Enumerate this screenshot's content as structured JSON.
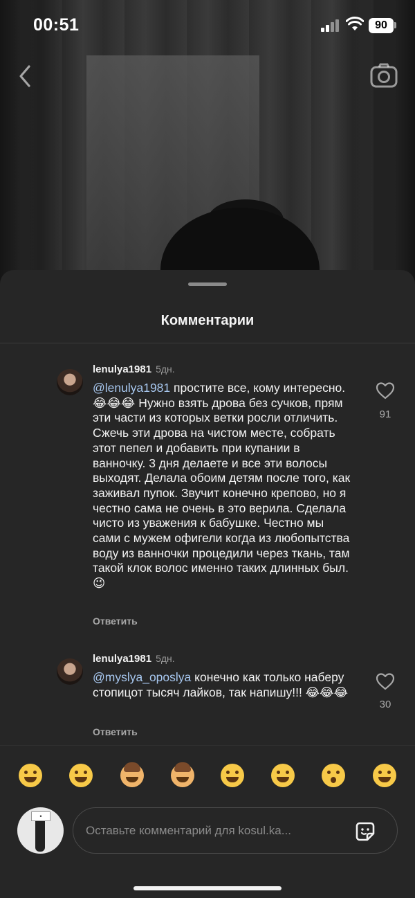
{
  "status_bar": {
    "time": "00:51",
    "battery": "90"
  },
  "sheet": {
    "title": "Комментарии"
  },
  "comments": [
    {
      "username": "lenulya1981",
      "time_ago": "5дн.",
      "mention": "@lenulya1981",
      "text": " простите все, кому интересно.😂😂😂 Нужно взять дрова без сучков,  прям эти части из которых ветки росли отличить. Сжечь эти дрова на чистом месте, собрать этот пепел и добавить при купании в ванночку. 3 дня делаете и все эти волосы выходят. Делала обоим детям после того, как заживал пупок. Звучит конечно крепово, но я честно сама не очень в это верила. Сделала чисто из уважения к бабушке. Честно мы сами с мужем офигели когда из любопытства воду из ванночки процедили через ткань, там такой клок волос именно таких длинных был. 😉",
      "likes": "91",
      "reply_label": "Ответить"
    },
    {
      "username": "lenulya1981",
      "time_ago": "5дн.",
      "mention": "@myslya_oposlya",
      "text": " конечно как только наберу стопицот тысяч лайков, так напишу!!! 😂😂😂",
      "likes": "30",
      "reply_label": "Ответить"
    }
  ],
  "quick_reactions": [
    "rolling-on-floor-laughing",
    "grinning-sweat",
    "facepalm",
    "shrug",
    "grinning",
    "grinning-big-eyes",
    "astonished",
    "tears-of-joy"
  ],
  "input": {
    "placeholder": "Оставьте комментарий для kosul.ka..."
  },
  "colors": {
    "sheet_bg": "#262626",
    "mention": "#a8c8f0",
    "muted": "#a8a8a8"
  }
}
